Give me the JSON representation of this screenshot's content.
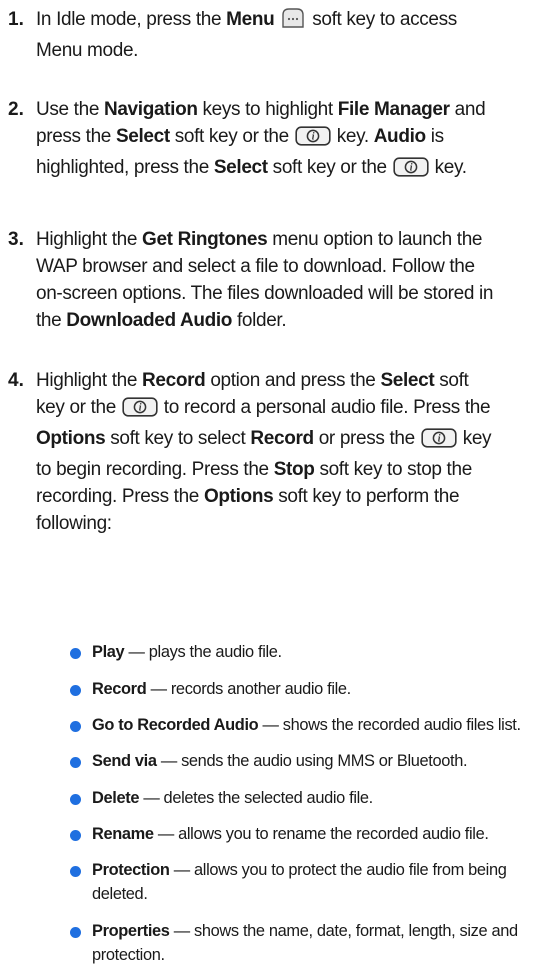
{
  "steps": [
    {
      "number": "1.",
      "lines": [
        [
          "In Idle mode, press the ",
          {
            "b": "Menu"
          },
          " ",
          {
            "icon": "menu-key-icon"
          },
          " soft key to access"
        ],
        [
          "Menu mode."
        ]
      ]
    },
    {
      "number": "2.",
      "lines": [
        [
          "Use the ",
          {
            "b": "Navigation"
          },
          " keys to highlight ",
          {
            "b": "File Manager"
          },
          " and"
        ],
        [
          "press the ",
          {
            "b": "Select"
          },
          " soft key or the ",
          {
            "icon": "ok-key-icon"
          },
          " key. ",
          {
            "b": "Audio"
          },
          " is"
        ],
        [
          "highlighted, press the ",
          {
            "b": "Select"
          },
          " soft key or the ",
          {
            "icon": "ok-key-icon"
          },
          " key."
        ]
      ]
    },
    {
      "number": "3.",
      "lines": [
        [
          "Highlight the ",
          {
            "b": "Get Ringtones"
          },
          " menu option to launch the"
        ],
        [
          "WAP browser and select a file to download. Follow the"
        ],
        [
          "on-screen options. The files downloaded will be stored in"
        ],
        [
          "the ",
          {
            "b": "Downloaded Audio"
          },
          " folder."
        ]
      ]
    },
    {
      "number": "4.",
      "lines": [
        [
          "Highlight the ",
          {
            "b": "Record"
          },
          " option and press the ",
          {
            "b": "Select"
          },
          " soft"
        ],
        [
          "key or the ",
          {
            "icon": "ok-key-icon"
          },
          " to record a personal audio file. Press the"
        ],
        [
          {
            "b": "Options"
          },
          " soft key to select ",
          {
            "b": "Record"
          },
          " or press the ",
          {
            "icon": "ok-key-icon"
          },
          " key"
        ],
        [
          "to begin recording. Press the ",
          {
            "b": "Stop"
          },
          " soft key to stop the"
        ],
        [
          "recording. Press the ",
          {
            "b": "Options"
          },
          " soft key to perform the"
        ],
        [
          "following:"
        ]
      ]
    }
  ],
  "bullets": [
    {
      "term": "Play",
      "desc": " — plays the audio file.",
      "lines": 1
    },
    {
      "term": "Record",
      "desc": " — records another audio file.",
      "lines": 1
    },
    {
      "term": "Go to Recorded Audio",
      "desc": " — shows the recorded audio files list.",
      "lines": 1
    },
    {
      "term": "Send via",
      "desc": " — sends the audio using MMS or Bluetooth.",
      "lines": 1
    },
    {
      "term": "Delete",
      "desc": " — deletes the selected audio file.",
      "lines": 1
    },
    {
      "term": "Rename",
      "desc": " — allows you to rename the recorded audio file.",
      "lines": 1
    },
    {
      "term": "Protection",
      "desc": " — allows you to protect the audio file from being deleted.",
      "lines": 2
    },
    {
      "term": "Properties",
      "desc": " — shows the name, date, format, length, size and protection.",
      "lines": 2
    }
  ],
  "icons": {
    "menu-key-icon": {
      "fill": "#e8e8e8",
      "stroke": "#555555"
    },
    "ok-key-icon": {
      "fill": "#f2f2f2",
      "stroke": "#333333"
    },
    "bullet_color": "#1f6fe0"
  }
}
